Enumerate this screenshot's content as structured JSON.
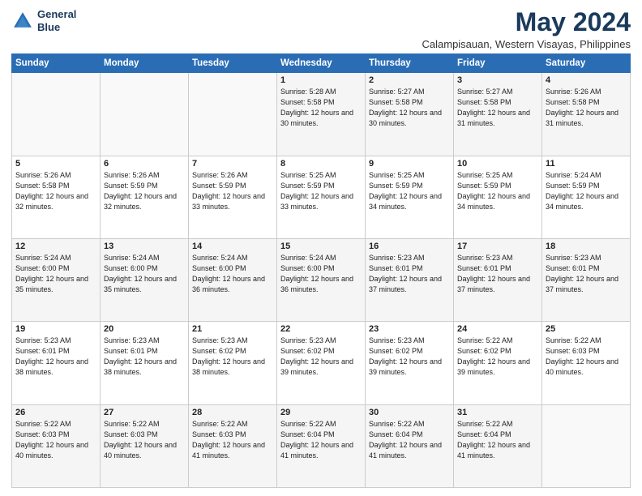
{
  "logo": {
    "line1": "General",
    "line2": "Blue"
  },
  "title": {
    "month_year": "May 2024",
    "location": "Calampisauan, Western Visayas, Philippines"
  },
  "days_of_week": [
    "Sunday",
    "Monday",
    "Tuesday",
    "Wednesday",
    "Thursday",
    "Friday",
    "Saturday"
  ],
  "weeks": [
    [
      {
        "day": "",
        "text": ""
      },
      {
        "day": "",
        "text": ""
      },
      {
        "day": "",
        "text": ""
      },
      {
        "day": "1",
        "text": "Sunrise: 5:28 AM\nSunset: 5:58 PM\nDaylight: 12 hours\nand 30 minutes."
      },
      {
        "day": "2",
        "text": "Sunrise: 5:27 AM\nSunset: 5:58 PM\nDaylight: 12 hours\nand 30 minutes."
      },
      {
        "day": "3",
        "text": "Sunrise: 5:27 AM\nSunset: 5:58 PM\nDaylight: 12 hours\nand 31 minutes."
      },
      {
        "day": "4",
        "text": "Sunrise: 5:26 AM\nSunset: 5:58 PM\nDaylight: 12 hours\nand 31 minutes."
      }
    ],
    [
      {
        "day": "5",
        "text": "Sunrise: 5:26 AM\nSunset: 5:58 PM\nDaylight: 12 hours\nand 32 minutes."
      },
      {
        "day": "6",
        "text": "Sunrise: 5:26 AM\nSunset: 5:59 PM\nDaylight: 12 hours\nand 32 minutes."
      },
      {
        "day": "7",
        "text": "Sunrise: 5:26 AM\nSunset: 5:59 PM\nDaylight: 12 hours\nand 33 minutes."
      },
      {
        "day": "8",
        "text": "Sunrise: 5:25 AM\nSunset: 5:59 PM\nDaylight: 12 hours\nand 33 minutes."
      },
      {
        "day": "9",
        "text": "Sunrise: 5:25 AM\nSunset: 5:59 PM\nDaylight: 12 hours\nand 34 minutes."
      },
      {
        "day": "10",
        "text": "Sunrise: 5:25 AM\nSunset: 5:59 PM\nDaylight: 12 hours\nand 34 minutes."
      },
      {
        "day": "11",
        "text": "Sunrise: 5:24 AM\nSunset: 5:59 PM\nDaylight: 12 hours\nand 34 minutes."
      }
    ],
    [
      {
        "day": "12",
        "text": "Sunrise: 5:24 AM\nSunset: 6:00 PM\nDaylight: 12 hours\nand 35 minutes."
      },
      {
        "day": "13",
        "text": "Sunrise: 5:24 AM\nSunset: 6:00 PM\nDaylight: 12 hours\nand 35 minutes."
      },
      {
        "day": "14",
        "text": "Sunrise: 5:24 AM\nSunset: 6:00 PM\nDaylight: 12 hours\nand 36 minutes."
      },
      {
        "day": "15",
        "text": "Sunrise: 5:24 AM\nSunset: 6:00 PM\nDaylight: 12 hours\nand 36 minutes."
      },
      {
        "day": "16",
        "text": "Sunrise: 5:23 AM\nSunset: 6:01 PM\nDaylight: 12 hours\nand 37 minutes."
      },
      {
        "day": "17",
        "text": "Sunrise: 5:23 AM\nSunset: 6:01 PM\nDaylight: 12 hours\nand 37 minutes."
      },
      {
        "day": "18",
        "text": "Sunrise: 5:23 AM\nSunset: 6:01 PM\nDaylight: 12 hours\nand 37 minutes."
      }
    ],
    [
      {
        "day": "19",
        "text": "Sunrise: 5:23 AM\nSunset: 6:01 PM\nDaylight: 12 hours\nand 38 minutes."
      },
      {
        "day": "20",
        "text": "Sunrise: 5:23 AM\nSunset: 6:01 PM\nDaylight: 12 hours\nand 38 minutes."
      },
      {
        "day": "21",
        "text": "Sunrise: 5:23 AM\nSunset: 6:02 PM\nDaylight: 12 hours\nand 38 minutes."
      },
      {
        "day": "22",
        "text": "Sunrise: 5:23 AM\nSunset: 6:02 PM\nDaylight: 12 hours\nand 39 minutes."
      },
      {
        "day": "23",
        "text": "Sunrise: 5:23 AM\nSunset: 6:02 PM\nDaylight: 12 hours\nand 39 minutes."
      },
      {
        "day": "24",
        "text": "Sunrise: 5:22 AM\nSunset: 6:02 PM\nDaylight: 12 hours\nand 39 minutes."
      },
      {
        "day": "25",
        "text": "Sunrise: 5:22 AM\nSunset: 6:03 PM\nDaylight: 12 hours\nand 40 minutes."
      }
    ],
    [
      {
        "day": "26",
        "text": "Sunrise: 5:22 AM\nSunset: 6:03 PM\nDaylight: 12 hours\nand 40 minutes."
      },
      {
        "day": "27",
        "text": "Sunrise: 5:22 AM\nSunset: 6:03 PM\nDaylight: 12 hours\nand 40 minutes."
      },
      {
        "day": "28",
        "text": "Sunrise: 5:22 AM\nSunset: 6:03 PM\nDaylight: 12 hours\nand 41 minutes."
      },
      {
        "day": "29",
        "text": "Sunrise: 5:22 AM\nSunset: 6:04 PM\nDaylight: 12 hours\nand 41 minutes."
      },
      {
        "day": "30",
        "text": "Sunrise: 5:22 AM\nSunset: 6:04 PM\nDaylight: 12 hours\nand 41 minutes."
      },
      {
        "day": "31",
        "text": "Sunrise: 5:22 AM\nSunset: 6:04 PM\nDaylight: 12 hours\nand 41 minutes."
      },
      {
        "day": "",
        "text": ""
      }
    ]
  ]
}
